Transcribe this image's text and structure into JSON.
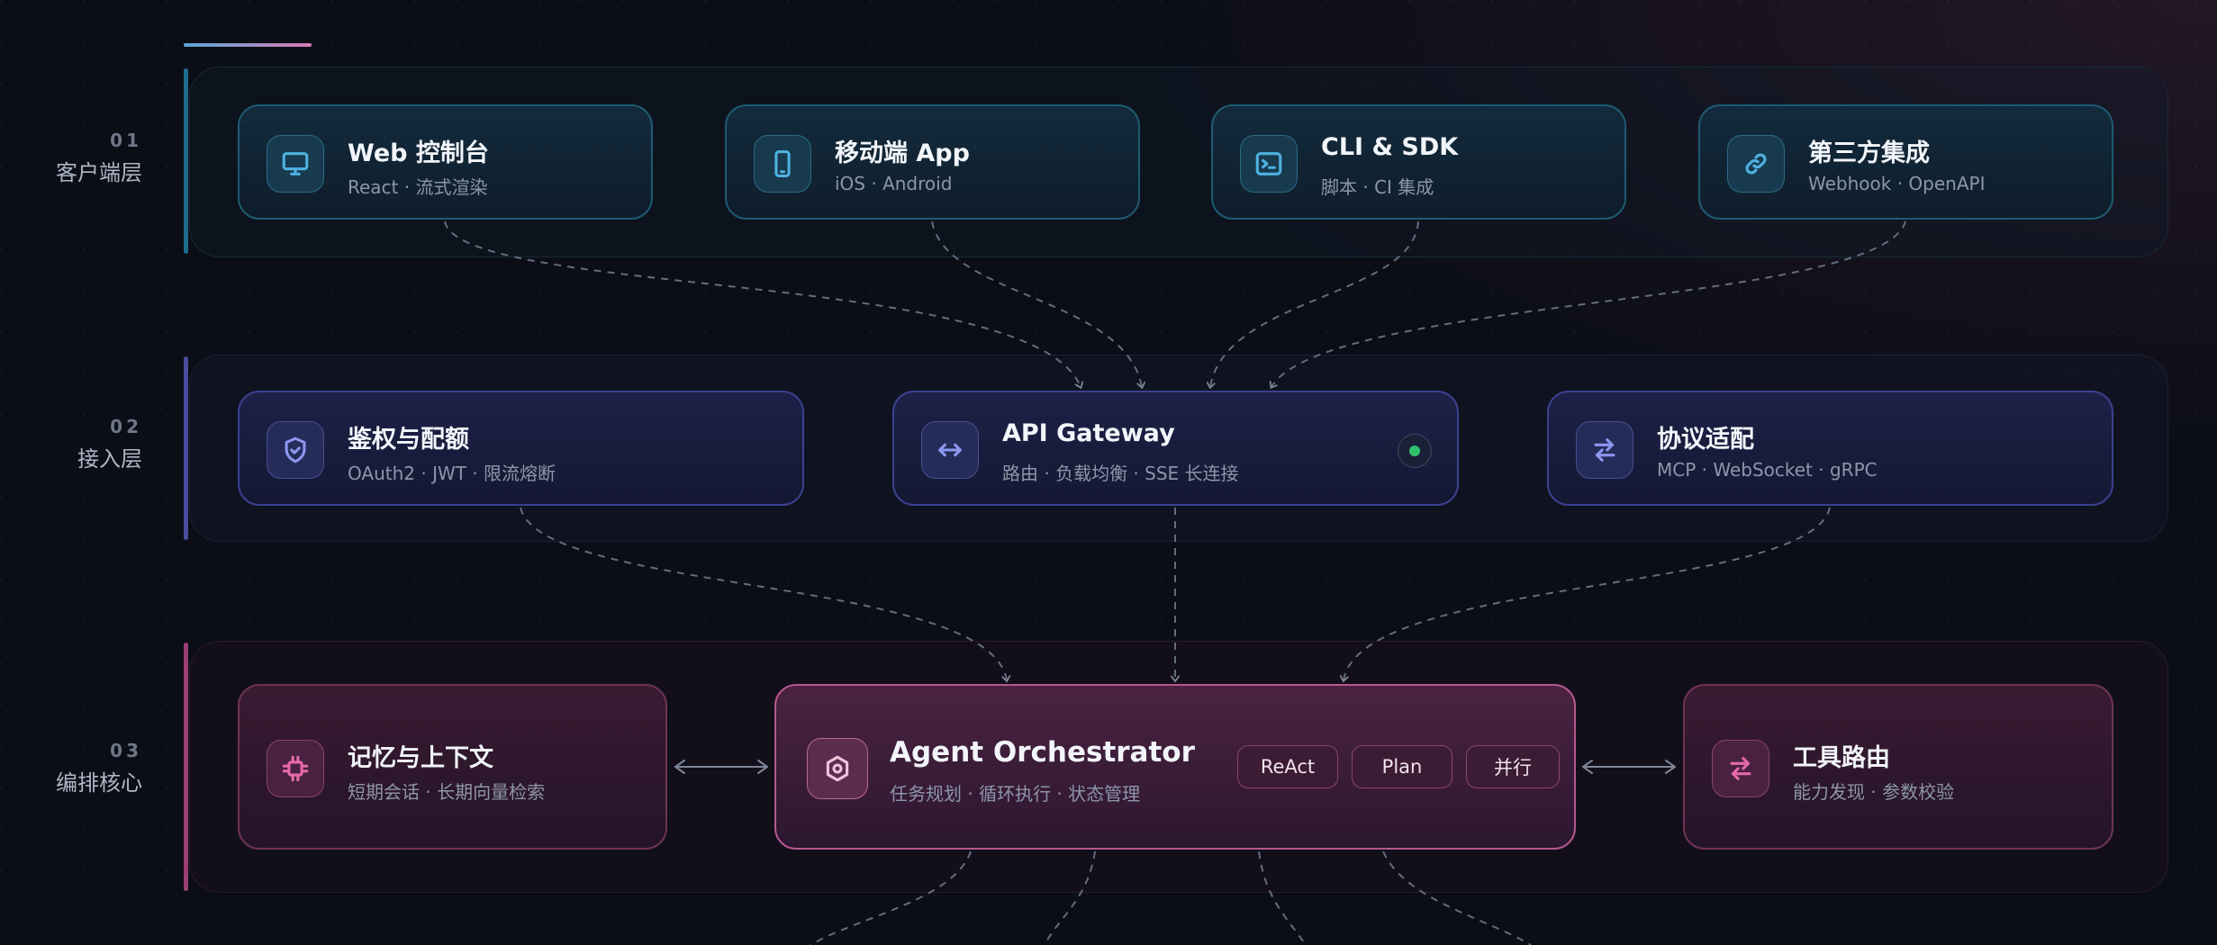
{
  "layers": [
    {
      "num": "01",
      "name": "客户端层",
      "color": "#1f6d8e"
    },
    {
      "num": "02",
      "name": "接入层",
      "color": "#4a4e9e"
    },
    {
      "num": "03",
      "name": "编排核心",
      "color": "#9a3f74"
    }
  ],
  "client_cards": [
    {
      "title": "Web 控制台",
      "sub": "React · 流式渲染",
      "icon": "monitor-icon"
    },
    {
      "title": "移动端 App",
      "sub": "iOS · Android",
      "icon": "smartphone-icon"
    },
    {
      "title": "CLI & SDK",
      "sub": "脚本 · CI 集成",
      "icon": "terminal-icon"
    },
    {
      "title": "第三方集成",
      "sub": "Webhook · OpenAPI",
      "icon": "link-icon"
    }
  ],
  "access_cards": [
    {
      "title": "鉴权与配额",
      "sub": "OAuth2 · JWT · 限流熔断",
      "icon": "shield-check-icon"
    },
    {
      "title": "API Gateway",
      "sub": "路由 · 负载均衡 · SSE 长连接",
      "icon": "arrows-horizontal-icon",
      "status": "online"
    },
    {
      "title": "协议适配",
      "sub": "MCP · WebSocket · gRPC",
      "icon": "swap-icon"
    }
  ],
  "core_cards": {
    "memory": {
      "title": "记忆与上下文",
      "sub": "短期会话 · 长期向量检索",
      "icon": "chip-icon"
    },
    "orchestrator": {
      "title": "Agent Orchestrator",
      "sub": "任务规划 · 循环执行 · 状态管理",
      "icon": "hexagon-icon",
      "chips": [
        "ReAct",
        "Plan",
        "并行"
      ]
    },
    "tools": {
      "title": "工具路由",
      "sub": "能力发现 · 参数校验",
      "icon": "swap-icon"
    }
  },
  "colors": {
    "client_accent": "#4fb2e0",
    "access_accent": "#8c97ef",
    "core_accent": "#e56aa8",
    "status_online": "#2fc26a",
    "connector": "#7d8698"
  }
}
